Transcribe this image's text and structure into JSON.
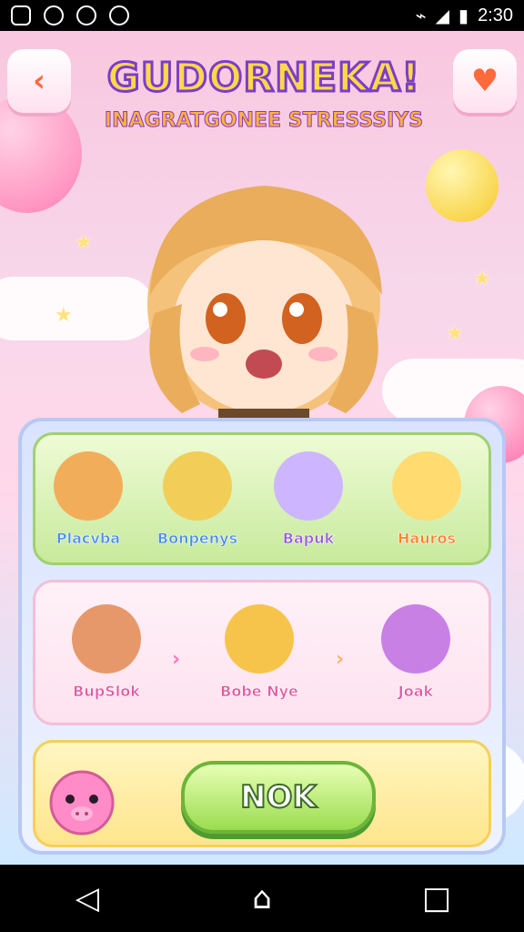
{
  "status_bar": {
    "time": "2:30",
    "left_icons": [
      "photo-icon",
      "chat-icon",
      "at-icon",
      "camera-icon"
    ],
    "right_icons": [
      "wifi-icon",
      "signal-icon",
      "battery-icon"
    ]
  },
  "header": {
    "back_icon": "chevron-left-icon",
    "title": "GUDORNEKA!",
    "subtitle": "INAGRATGONEE STRESSSIYS",
    "right_button_icon": "heart-icon"
  },
  "panel": {
    "row1": {
      "items": [
        {
          "label": "Placvba",
          "icon": "fox-face-icon",
          "color": "#f2ad5b"
        },
        {
          "label": "Bonpenys",
          "icon": "bear-face-icon",
          "color": "#f2ce58"
        },
        {
          "label": "Bapuk",
          "icon": "cat-face-icon",
          "color": "#cdb6ff"
        },
        {
          "label": "Hauros",
          "icon": "cat-face-icon",
          "color": "#ffdb70"
        }
      ]
    },
    "row2": {
      "items": [
        {
          "label": "BupSlok",
          "icon": "girl-face-icon",
          "color": "#e7986a"
        },
        {
          "label": "Bobe Nye",
          "icon": "girl-face-icon",
          "color": "#f7c44b"
        },
        {
          "label": "Joak",
          "icon": "girl-face-icon",
          "color": "#c880e4"
        }
      ],
      "arrow_icon": "chevron-right-icon"
    },
    "row3": {
      "mascot_icon": "pig-face-icon",
      "ok_label": "NOK"
    }
  },
  "navbar": {
    "back_icon": "back-triangle-icon",
    "home_icon": "home-icon",
    "recent_icon": "recent-square-icon"
  }
}
